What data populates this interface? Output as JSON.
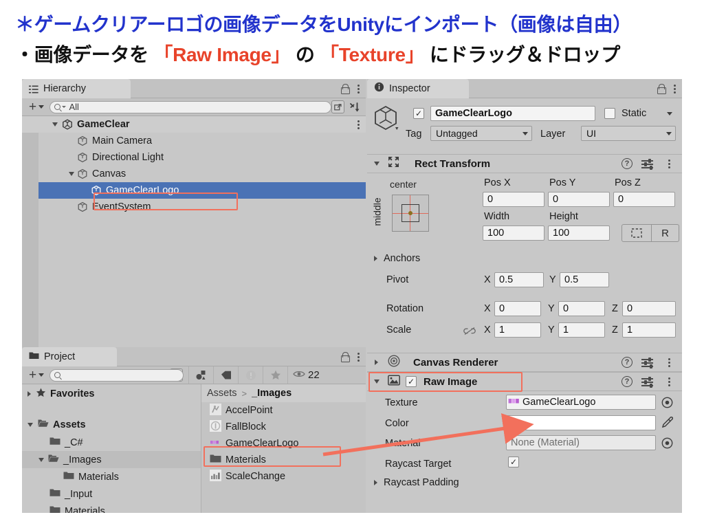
{
  "header": {
    "line1": "＊ゲームクリアーロゴの画像データをUnityにインポート（画像は自由）",
    "line2_a": "・画像データを ",
    "line2_b": "「Raw Image」",
    "line2_c": " の ",
    "line2_d": "「Texture」",
    "line2_e": " にドラッグ＆ドロップ",
    "title_color": "#2233cc",
    "highlight_color": "#e8432a"
  },
  "hierarchy": {
    "tab_label": "Hierarchy",
    "tab_icon": "hierarchy-icon",
    "lock_icon": "lock-icon",
    "menu_icon": "kebab-menu-icon",
    "add_label": "+",
    "search_value": "All",
    "rows": [
      {
        "label": "GameClear",
        "depth": 1,
        "bold": true,
        "twisty": "open",
        "selected": false,
        "kebab": true
      },
      {
        "label": "Main Camera",
        "depth": 2,
        "bold": false,
        "twisty": "none",
        "selected": false,
        "kebab": false
      },
      {
        "label": "Directional Light",
        "depth": 2,
        "bold": false,
        "twisty": "none",
        "selected": false,
        "kebab": false
      },
      {
        "label": "Canvas",
        "depth": 2,
        "bold": false,
        "twisty": "open",
        "selected": false,
        "kebab": false
      },
      {
        "label": "GameClearLogo",
        "depth": 3,
        "bold": false,
        "twisty": "none",
        "selected": true,
        "kebab": false
      },
      {
        "label": "EventSystem",
        "depth": 2,
        "bold": false,
        "twisty": "none",
        "selected": false,
        "kebab": false
      }
    ]
  },
  "project": {
    "tab_label": "Project",
    "tab_icon": "folder-icon",
    "search_placeholder": "",
    "visible_count": "22",
    "toolbar_icons": [
      "asset-filter-icon",
      "label-tag-icon",
      "warning-icon",
      "favorite-star-icon",
      "visibility-eye-icon"
    ],
    "tree": [
      {
        "label": "Favorites",
        "depth": 0,
        "bold": true,
        "twisty": "closed",
        "icon": "star-icon",
        "selected": false
      },
      {
        "label": "Assets",
        "depth": 0,
        "bold": true,
        "twisty": "open",
        "icon": "folder-open-icon",
        "selected": false
      },
      {
        "label": "_C#",
        "depth": 1,
        "bold": false,
        "twisty": "none",
        "icon": "folder-icon",
        "selected": false
      },
      {
        "label": "_Images",
        "depth": 1,
        "bold": false,
        "twisty": "open",
        "icon": "folder-open-icon",
        "selected": true
      },
      {
        "label": "Materials",
        "depth": 2,
        "bold": false,
        "twisty": "none",
        "icon": "folder-icon",
        "selected": false
      },
      {
        "label": "_Input",
        "depth": 1,
        "bold": false,
        "twisty": "none",
        "icon": "folder-icon",
        "selected": false
      },
      {
        "label": "Materials",
        "depth": 1,
        "bold": false,
        "twisty": "none",
        "icon": "folder-icon",
        "selected": false
      }
    ],
    "breadcrumb": {
      "root": "Assets",
      "separator": ">",
      "current": "_Images"
    },
    "assets": [
      {
        "label": "AccelPoint",
        "icon": "texture-thumb-icon",
        "highlight": false
      },
      {
        "label": "FallBlock",
        "icon": "texture-thumb-icon",
        "highlight": false
      },
      {
        "label": "GameClearLogo",
        "icon": "texture-thumb-icon",
        "highlight": true
      },
      {
        "label": "Materials",
        "icon": "folder-icon",
        "highlight": false
      },
      {
        "label": "ScaleChange",
        "icon": "texture-thumb-icon",
        "highlight": false
      }
    ]
  },
  "inspector": {
    "tab_label": "Inspector",
    "tab_icon": "info-icon",
    "lock_icon": "lock-icon",
    "menu_icon": "kebab-menu-icon",
    "object_enabled": true,
    "object_name": "GameClearLogo",
    "static_label": "Static",
    "static_checked": false,
    "tag_label": "Tag",
    "tag_value": "Untagged",
    "layer_label": "Layer",
    "layer_value": "UI",
    "rect_transform": {
      "title": "Rect Transform",
      "anchor_preset_h": "center",
      "anchor_preset_v": "middle",
      "pos_x_label": "Pos X",
      "pos_x": "0",
      "pos_y_label": "Pos Y",
      "pos_y": "0",
      "pos_z_label": "Pos Z",
      "pos_z": "0",
      "width_label": "Width",
      "width": "100",
      "height_label": "Height",
      "height": "100",
      "blueprint_button": "blueprint-mode-icon",
      "raw_button": "R",
      "anchors_label": "Anchors",
      "pivot_label": "Pivot",
      "pivot_x": "0.5",
      "pivot_y": "0.5",
      "rotation_label": "Rotation",
      "rot_x": "0",
      "rot_y": "0",
      "rot_z": "0",
      "scale_label": "Scale",
      "scale_x": "1",
      "scale_y": "1",
      "scale_z": "1",
      "axis_x": "X",
      "axis_y": "Y",
      "axis_z": "Z"
    },
    "canvas_renderer": {
      "title": "Canvas Renderer",
      "icon": "canvas-renderer-icon"
    },
    "raw_image": {
      "title": "Raw Image",
      "icon": "raw-image-icon",
      "enabled": true,
      "texture_label": "Texture",
      "texture_value": "GameClearLogo",
      "color_label": "Color",
      "color_value": "#ffffff",
      "material_label": "Material",
      "material_value": "None (Material)",
      "raycast_target_label": "Raycast Target",
      "raycast_target_checked": true,
      "raycast_padding_label": "Raycast Padding",
      "picker_icon": "object-picker-icon",
      "eyedropper_icon": "eyedropper-icon"
    }
  },
  "annotations": {
    "arrow_color": "#f2705c",
    "box_color": "#f2705c"
  }
}
